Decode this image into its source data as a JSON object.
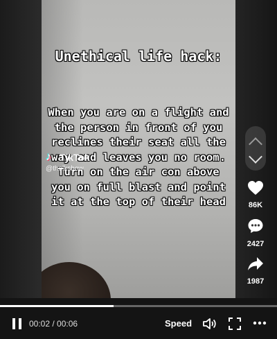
{
  "overlay": {
    "title": "Unethical life hack:",
    "body": "When you are on a flight and the person in front of you reclines their seat all the way and leaves you no room. Turn on the air con above you on full blast and point it at the top of their head"
  },
  "watermark": {
    "brand": "TikTok",
    "handle": "@thelkshow"
  },
  "actions": {
    "likes": "86K",
    "comments": "2427",
    "shares": "1987"
  },
  "player": {
    "time": "00:02 / 00:06",
    "speed_label": "Speed",
    "progress": 0.41
  },
  "icons": [
    "chevron-up-icon",
    "chevron-down-icon",
    "heart-icon",
    "comment-icon",
    "share-icon",
    "pause-icon",
    "volume-icon",
    "fullscreen-icon",
    "more-icon"
  ]
}
